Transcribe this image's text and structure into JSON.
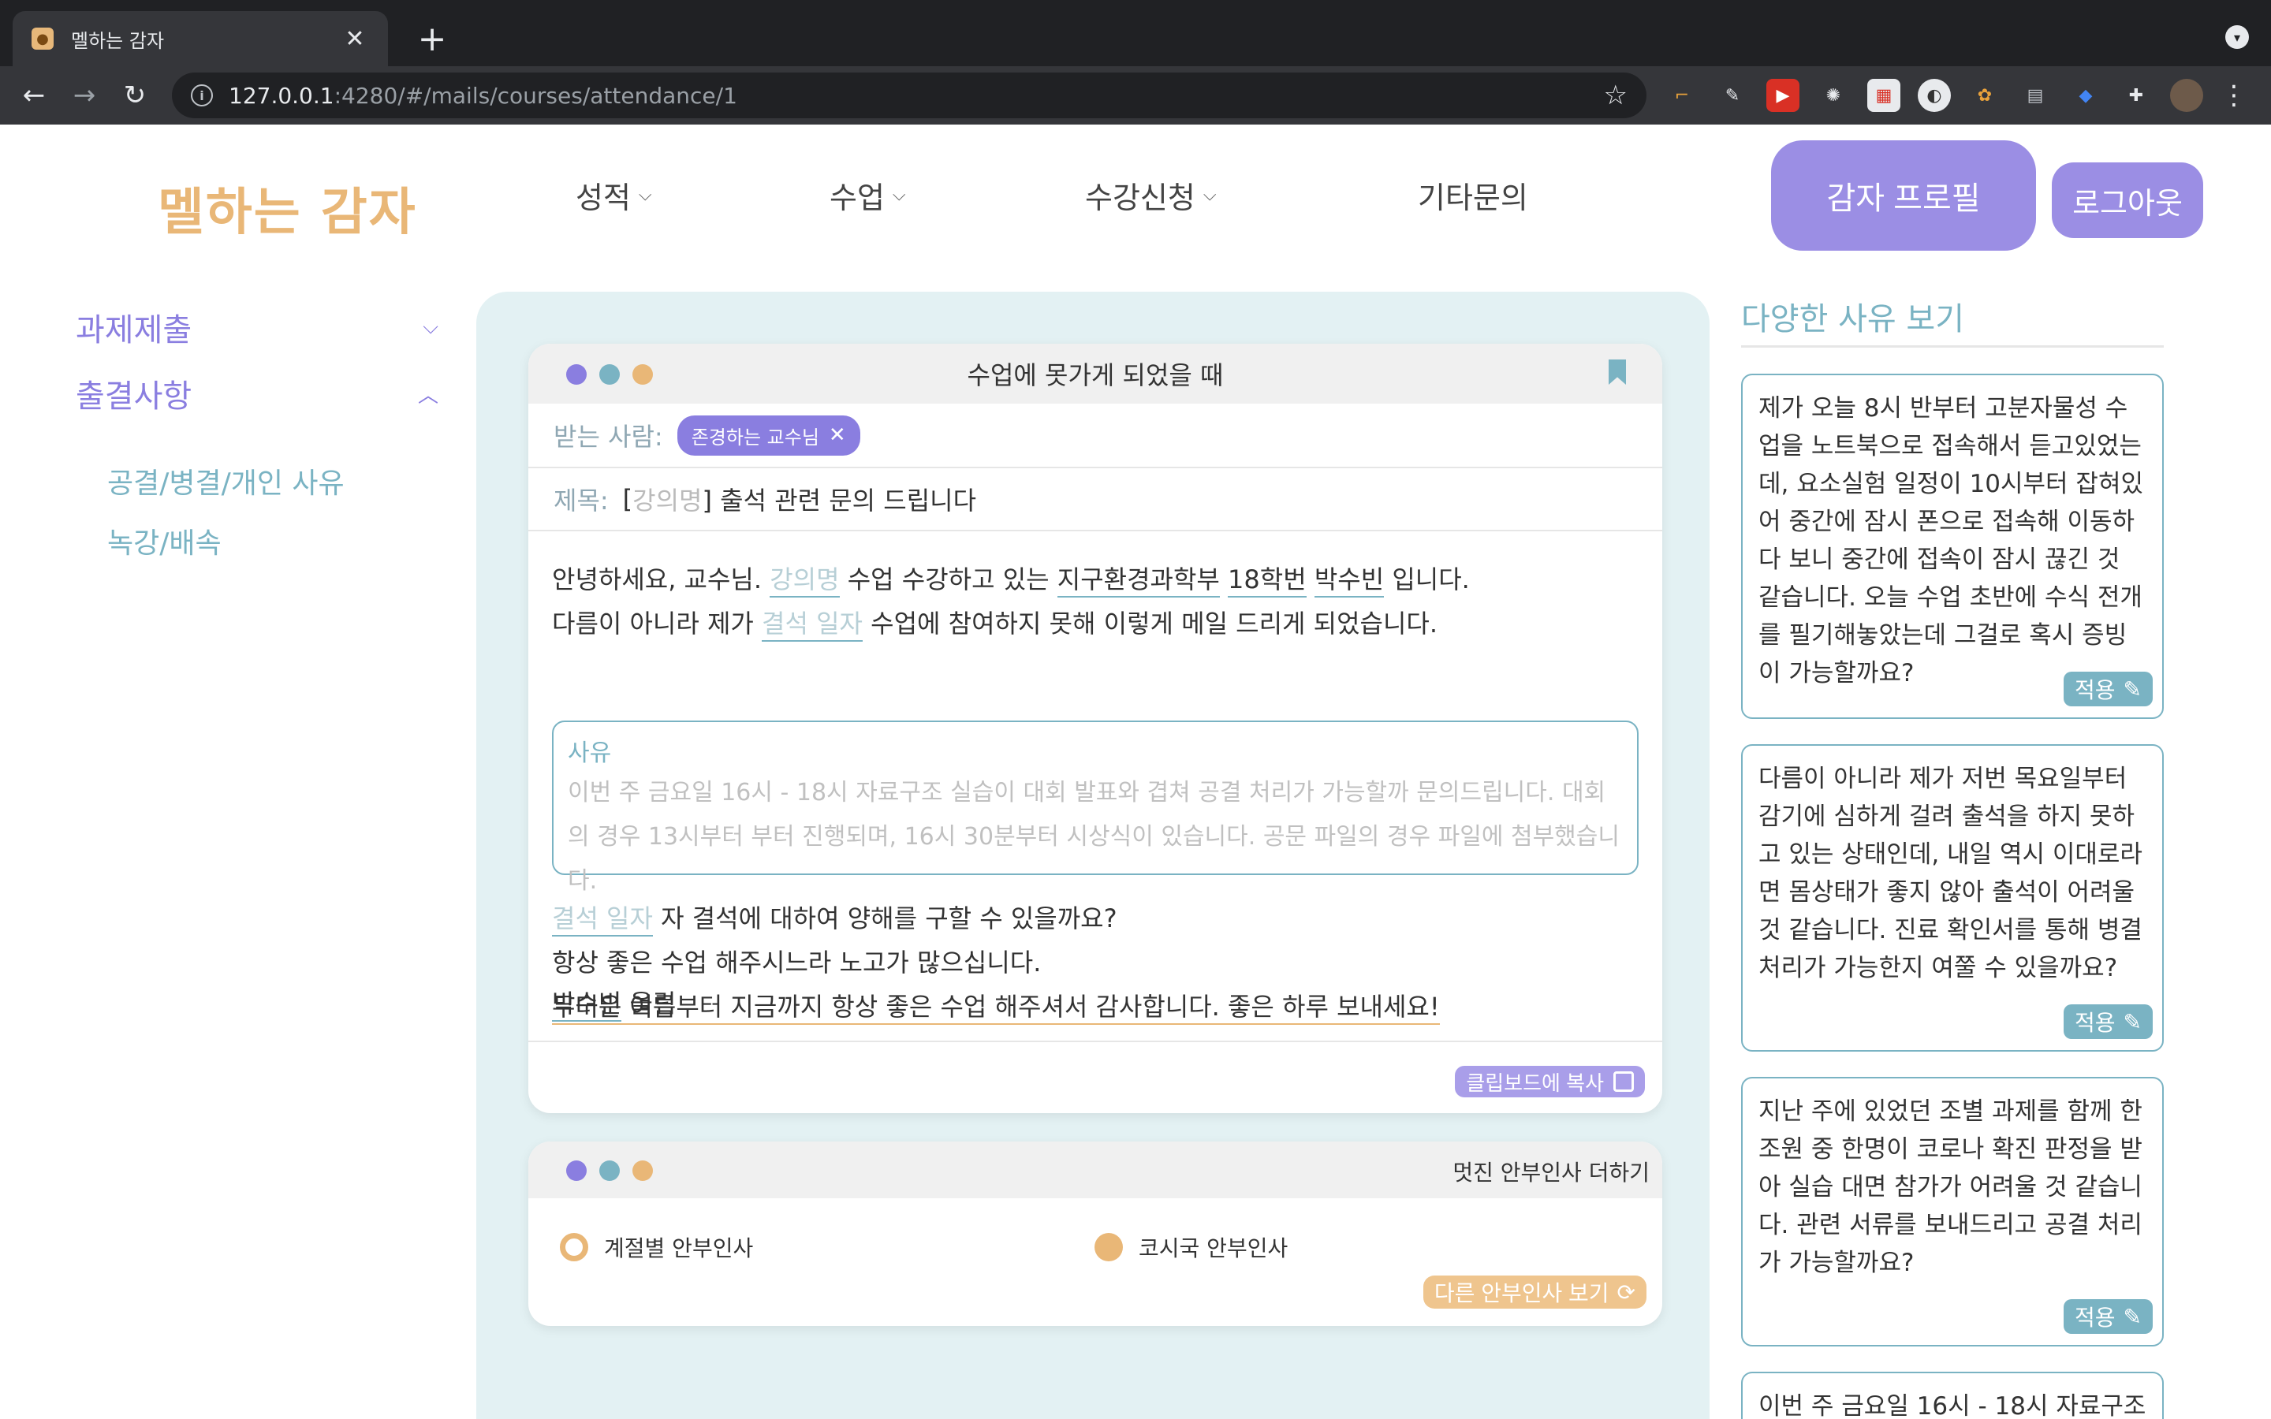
{
  "browser": {
    "tab_title": "멜하는 감자",
    "url_host": "127.0.0.1",
    "url_rest": ":4280/#/mails/courses/attendance/1"
  },
  "app": {
    "logo": "멜하는 감자",
    "nav": [
      "성적",
      "수업",
      "수강신청",
      "기타문의"
    ],
    "profile_button": "감자 프로필",
    "logout_button": "로그아웃"
  },
  "sidebar": {
    "sections": [
      {
        "label": "과제제출",
        "expanded": false
      },
      {
        "label": "출결사항",
        "expanded": true
      }
    ],
    "sub_items": [
      "공결/병결/개인 사유",
      "녹강/배속"
    ]
  },
  "mail": {
    "title": "수업에 못가게 되었을 때",
    "to_label": "받는 사람:",
    "recipient": "존경하는 교수님",
    "subject_label": "제목:",
    "subject_prefix": "[",
    "subject_course": "강의명",
    "subject_rest": "] 출석 관련 문의 드립니다",
    "line1_a": "안녕하세요, 교수님.",
    "line1_course": "강의명",
    "line1_b": "수업 수강하고 있는",
    "line1_dept": "지구환경과학부",
    "line1_id": "18학번",
    "line1_name": "박수빈",
    "line1_c": "입니다.",
    "line2_a": "다름이 아니라 제가",
    "line2_date": "결석 일자",
    "line2_b": "수업에 참여하지 못해 이렇게 메일 드리게 되었습니다.",
    "reason_label": "사유",
    "reason_text": "이번 주 금요일 16시 - 18시 자료구조 실습이 대회 발표와 겹쳐 공결 처리가 가능할까 문의드립니다. 대회의 경우 13시부터 부터 진행되며, 16시 30분부터 시상식이 있습니다. 공문 파일의 경우 파일에 첨부했습니다.",
    "line3_date": "결석 일자",
    "line3_rest": "자 결석에 대하여 양해를 구할 수 있을까요?",
    "line4": "항상 좋은 수업 해주시느라 노고가 많으십니다.",
    "line5": "무더운 여름부터 지금까지 항상 좋은 수업 해주셔서 감사합니다. 좋은 하루 보내세요!",
    "line6_name": "박수빈",
    "line6_rest": "올림",
    "copy_button": "클립보드에 복사"
  },
  "greeting": {
    "title": "멋진 안부인사 더하기",
    "options": [
      {
        "label": "계절별 안부인사",
        "selected": true
      },
      {
        "label": "코시국 안부인사",
        "selected": false
      }
    ],
    "more_button": "다른 안부인사 보기"
  },
  "reasons": {
    "title": "다양한 사유 보기",
    "apply_label": "적용",
    "cards": [
      "제가 오늘 8시 반부터 고분자물성 수업을 노트북으로 접속해서 듣고있었는데, 요소실험 일정이 10시부터 잡혀있어 중간에 잠시 폰으로 접속해 이동하다 보니 중간에 접속이 잠시 끊긴 것 같습니다. 오늘 수업 초반에 수식 전개를 필기해놓았는데 그걸로 혹시 증빙이 가능할까요?",
      "다름이 아니라 제가 저번 목요일부터 감기에 심하게 걸려 출석을 하지 못하고 있는 상태인데, 내일 역시 이대로라면 몸상태가 좋지 않아 출석이 어려울 것 같습니다. 진료 확인서를 통해 병결 처리가 가능한지 여쭐 수 있을까요?",
      "지난 주에 있었던 조별 과제를 함께 한 조원 중 한명이 코로나 확진 판정을 받아 실습 대면 참가가 어려울 것 같습니다. 관련 서류를 보내드리고 공결 처리가 가능할까요?",
      "이번 주 금요일 16시 - 18시 자료구조"
    ]
  },
  "colors": {
    "purple": "#8a7ee0",
    "teal": "#7ab3c3",
    "orange": "#e9b777",
    "panel_bg": "#e3f1f3"
  }
}
